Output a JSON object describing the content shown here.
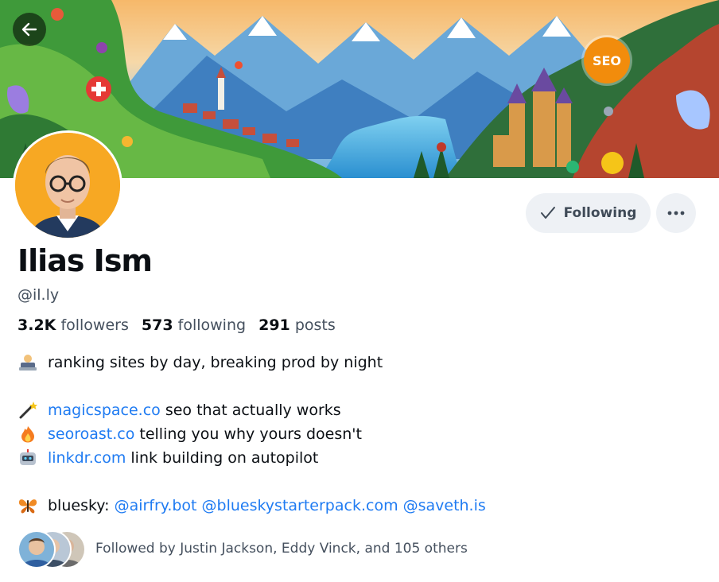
{
  "header": {
    "back_icon": "arrow-left-icon",
    "banner_badge": "SEO"
  },
  "profile": {
    "name": "Ilias Ism",
    "handle": "@il.ly",
    "follow_button_label": "Following",
    "follow_icon": "check-icon",
    "more_icon": "ellipsis-icon",
    "stats": {
      "followers_count": "3.2K",
      "followers_label": "followers",
      "following_count": "573",
      "following_label": "following",
      "posts_count": "291",
      "posts_label": "posts"
    }
  },
  "bio": {
    "line1": {
      "emoji": "technologist-emoji",
      "text": "ranking sites by day, breaking prod by night"
    },
    "line2": {
      "emoji": "magic-wand-emoji",
      "link": "magicspace.co",
      "text": "seo that actually works"
    },
    "line3": {
      "emoji": "fire-emoji",
      "link": "seoroast.co",
      "text": "telling you why yours doesn't"
    },
    "line4": {
      "emoji": "robot-emoji",
      "link": "linkdr.com",
      "text": "link building on autopilot"
    },
    "line5": {
      "emoji": "butterfly-emoji",
      "prefix": "bluesky:",
      "mentions": [
        "@airfry.bot",
        "@blueskystarterpack.com",
        "@saveth.is"
      ]
    }
  },
  "followed_by": {
    "text": "Followed by Justin Jackson, Eddy Vinck, and 105 others"
  },
  "colors": {
    "accent": "#1f7bf2",
    "avatar_bg": "#f7a823",
    "button_bg": "#eef1f5",
    "muted_text": "#45505e",
    "seo_badge": "#f28c0c"
  }
}
